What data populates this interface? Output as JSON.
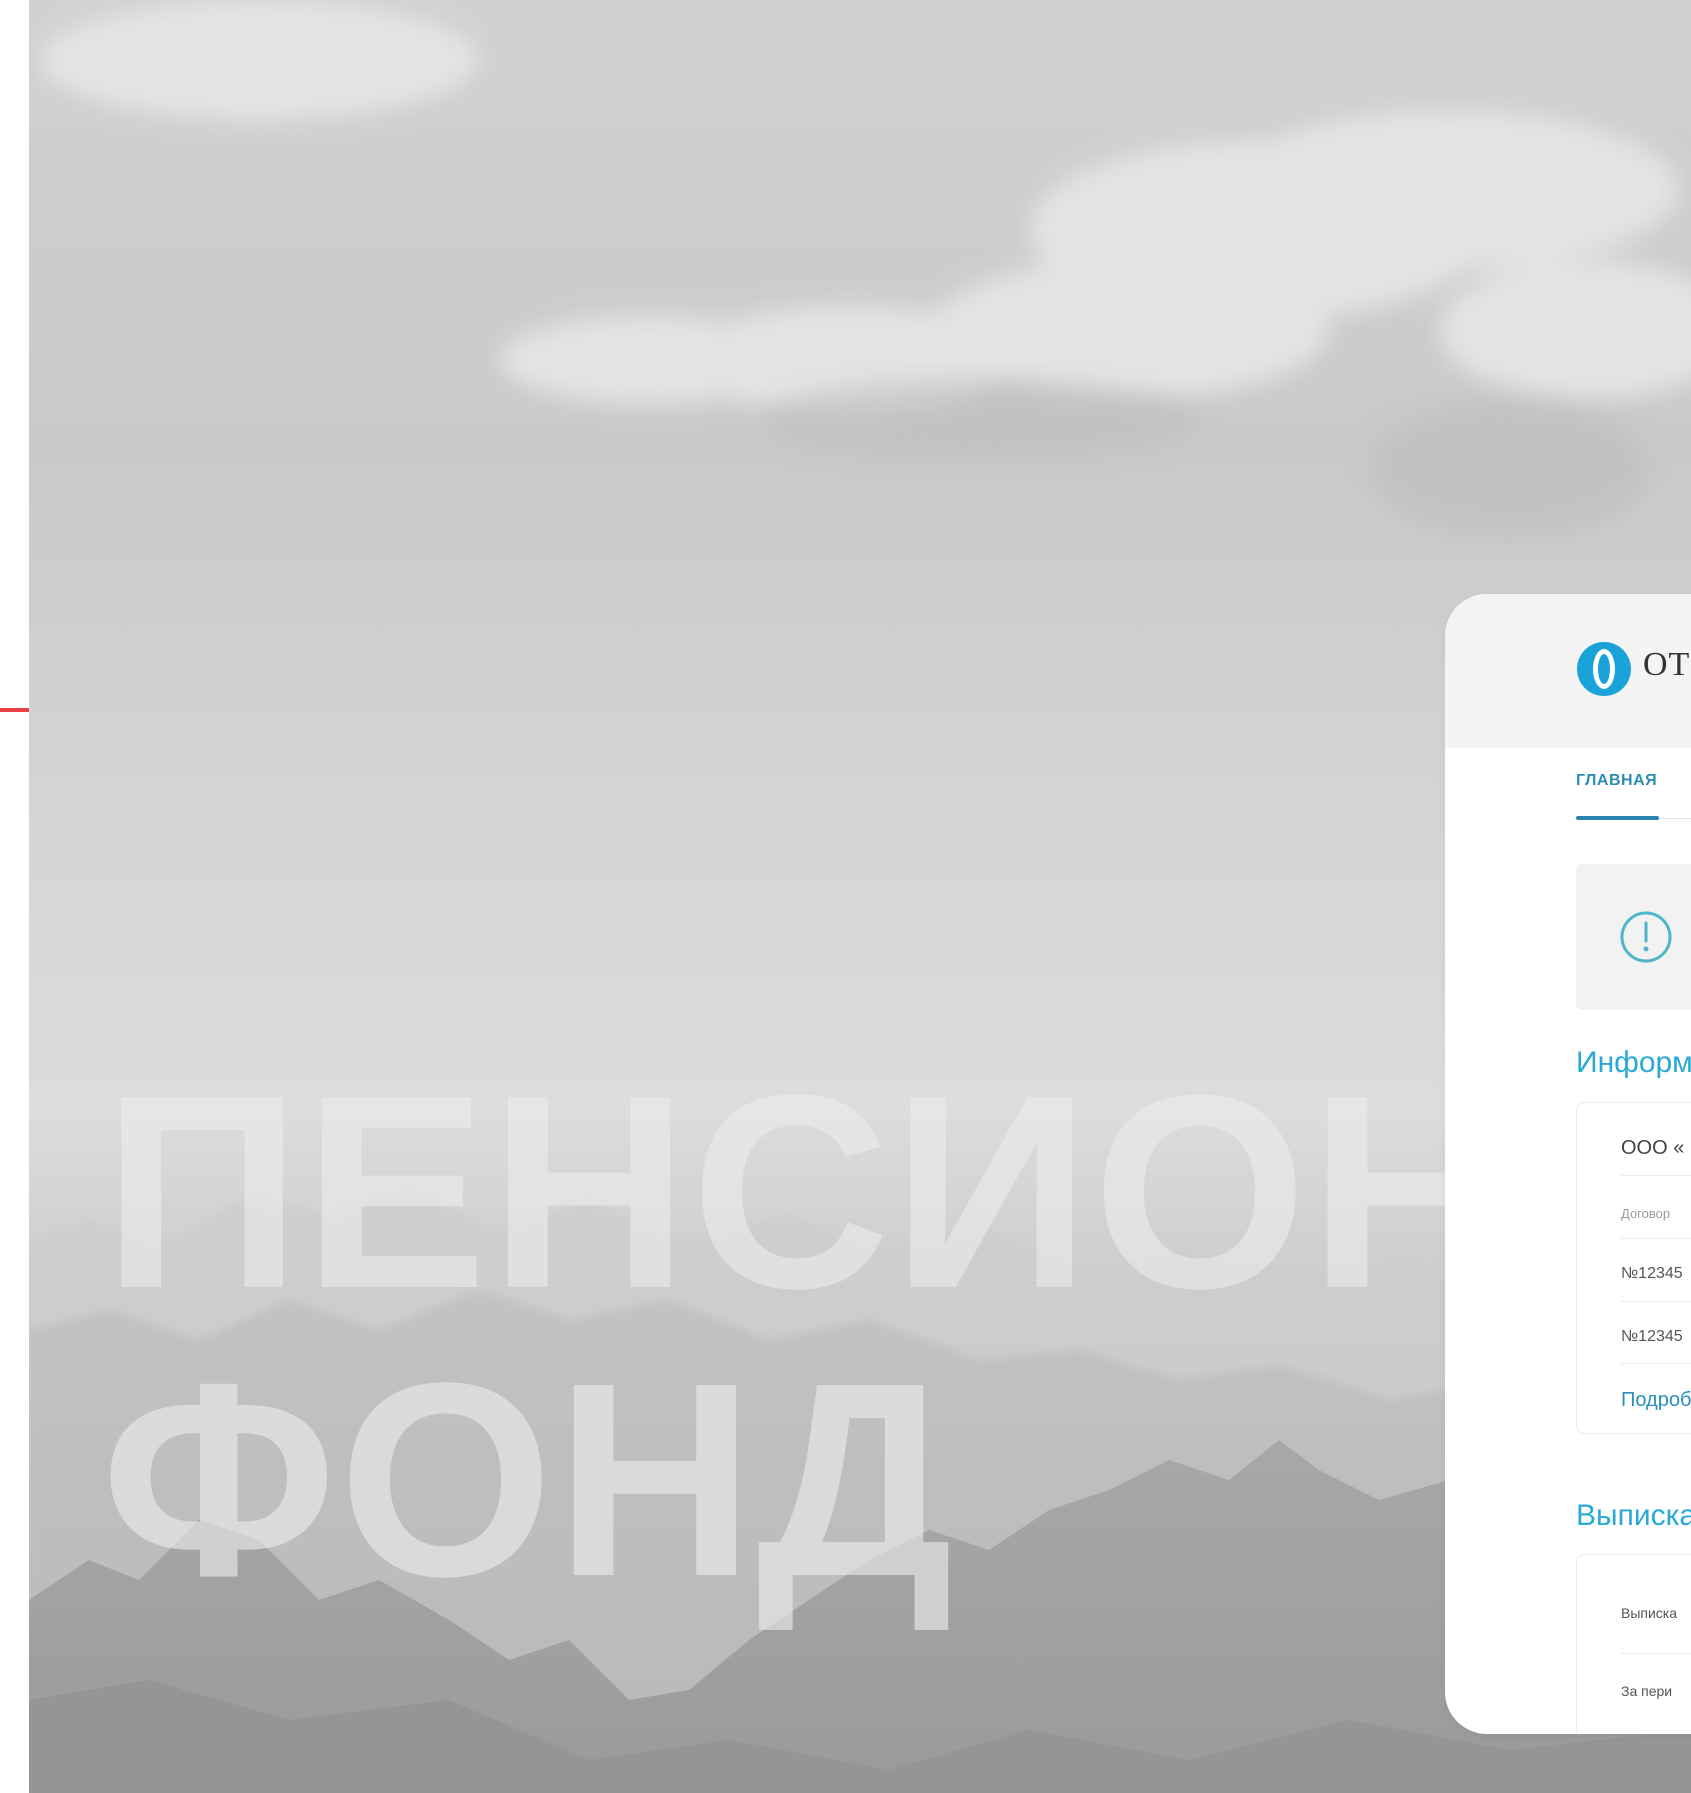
{
  "hero": {
    "title_line1": "ПЕНСИОН",
    "title_line2": "ФОНД"
  },
  "app": {
    "brand_name": "ОТ",
    "tab_home": "ГЛАВНАЯ",
    "info_title": "Информ",
    "company": "ООО «",
    "contract_label": "Договор",
    "contracts": [
      "№12345",
      "№12345"
    ],
    "details_link": "Подроб",
    "statement_title": "Выписка",
    "statement_rows": [
      "Выписка",
      "За пери"
    ]
  },
  "colors": {
    "accent_line": "#e8414a",
    "brand_blue": "#2aa9d6",
    "tab_active": "#2a84ad"
  },
  "icons": {
    "logo": "brand-logo-icon",
    "alert": "alert-circle-icon"
  }
}
